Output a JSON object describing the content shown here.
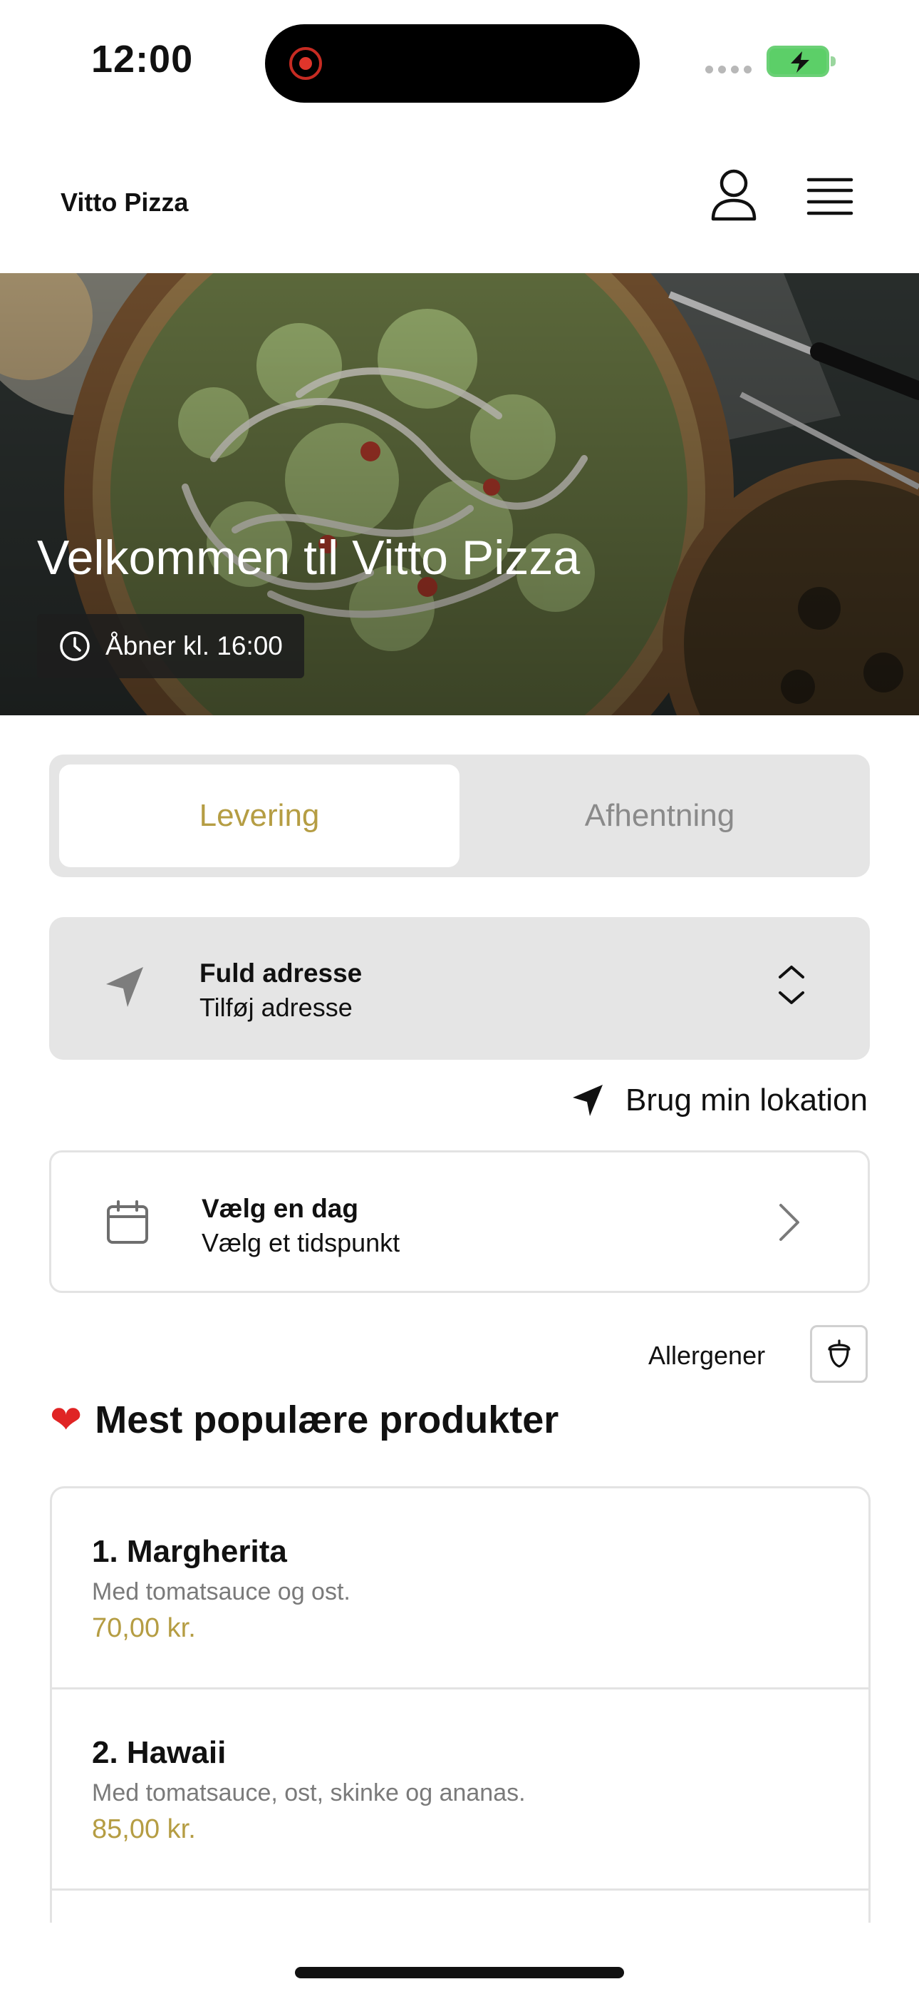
{
  "status_bar": {
    "time": "12:00"
  },
  "header": {
    "brand": "Vitto Pizza"
  },
  "hero": {
    "title": "Velkommen til Vitto Pizza",
    "opening_badge": "Åbner kl. 16:00"
  },
  "order_mode": {
    "tabs": [
      {
        "label": "Levering",
        "active": true
      },
      {
        "label": "Afhentning",
        "active": false
      }
    ]
  },
  "address": {
    "title": "Fuld adresse",
    "subtitle": "Tilføj adresse"
  },
  "location_link": "Brug min lokation",
  "schedule": {
    "title": "Vælg en dag",
    "subtitle": "Vælg et tidspunkt"
  },
  "allergens": {
    "label": "Allergener"
  },
  "popular": {
    "heading": "Mest populære produkter",
    "products": [
      {
        "name": "1. Margherita",
        "description": "Med tomatsauce og ost.",
        "price": "70,00 kr."
      },
      {
        "name": "2. Hawaii",
        "description": "Med tomatsauce, ost, skinke og ananas.",
        "price": "85,00 kr."
      }
    ]
  },
  "colors": {
    "accent": "#b59d43",
    "segment_bg": "#e5e5e5",
    "heart": "#e02424"
  },
  "icons": [
    "user-icon",
    "menu-icon",
    "clock-icon",
    "location-arrow-icon",
    "up-down-chevron-icon",
    "calendar-icon",
    "chevron-right-icon",
    "acorn-icon",
    "heart-icon"
  ]
}
